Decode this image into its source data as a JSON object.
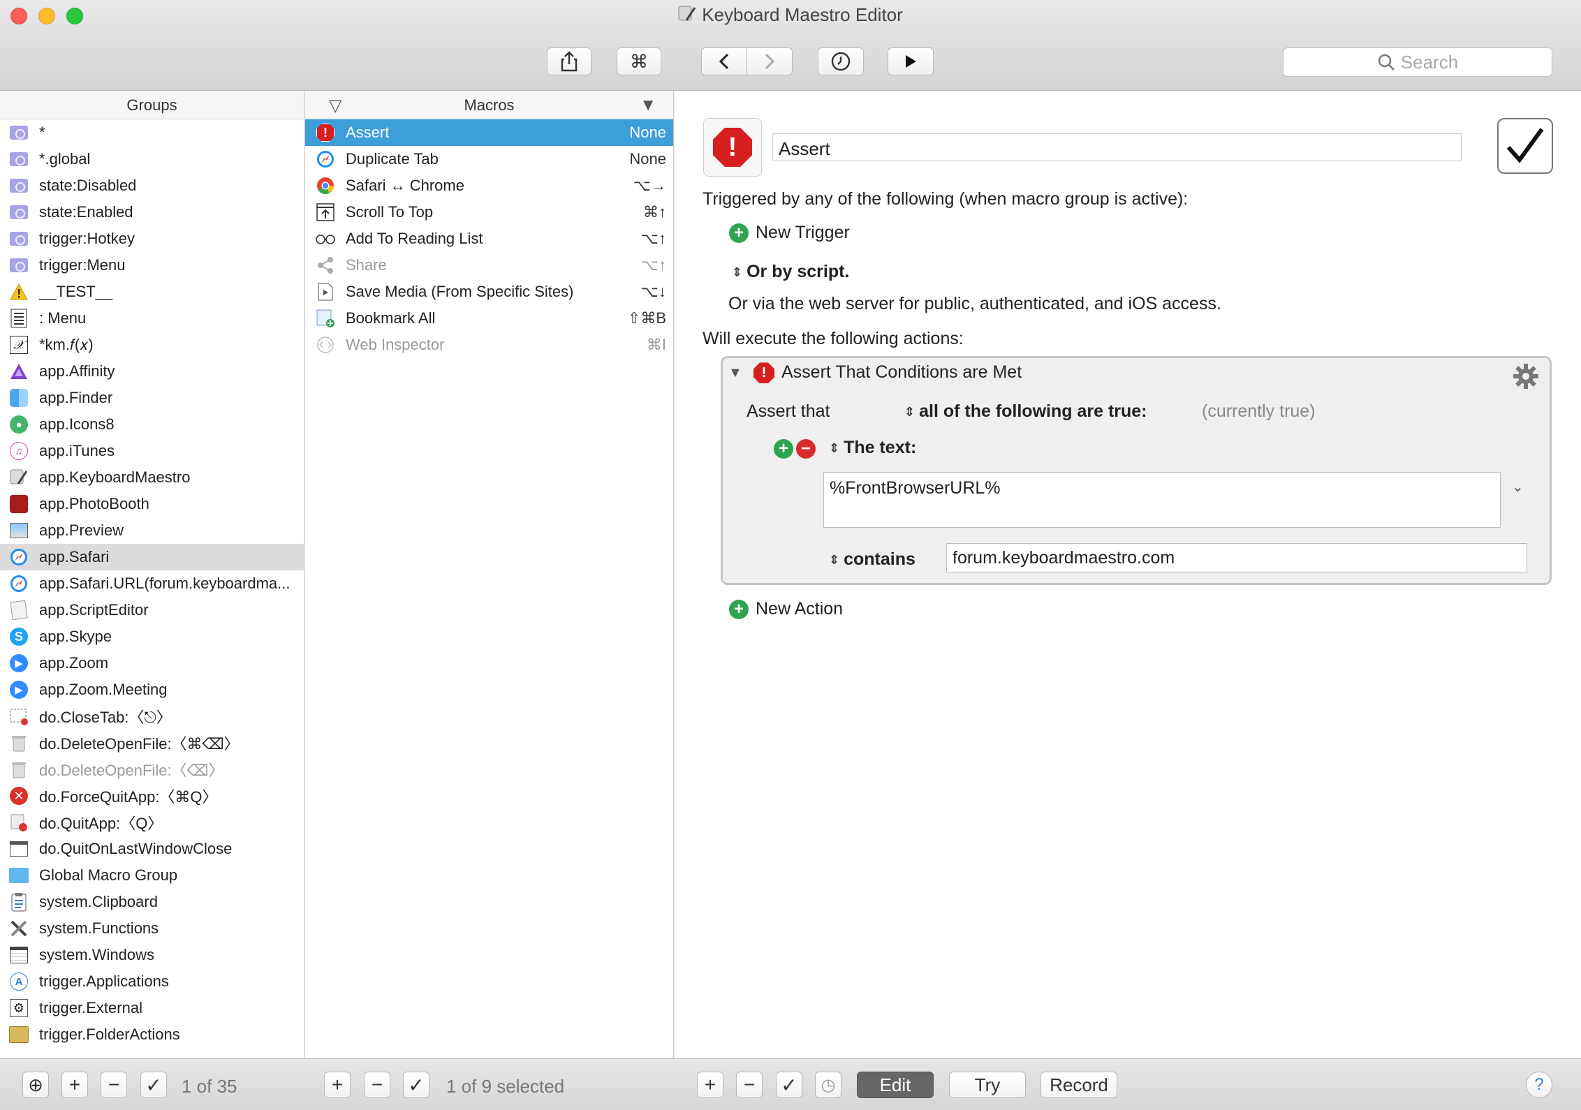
{
  "window": {
    "title": "Keyboard Maestro Editor"
  },
  "toolbar": {
    "search_placeholder": "Search"
  },
  "groups": {
    "header": "Groups",
    "count": "1 of 35",
    "items": [
      {
        "label": "*",
        "icon": "smart-group-icon"
      },
      {
        "label": "*.global",
        "icon": "smart-group-icon"
      },
      {
        "label": "state:Disabled",
        "icon": "smart-group-icon"
      },
      {
        "label": "state:Enabled",
        "icon": "smart-group-icon"
      },
      {
        "label": "trigger:Hotkey",
        "icon": "smart-group-icon"
      },
      {
        "label": "trigger:Menu",
        "icon": "smart-group-icon"
      },
      {
        "label": "__TEST__",
        "icon": "warning-icon"
      },
      {
        "label": ": Menu",
        "icon": "list-icon"
      },
      {
        "label": "*km.𝑓(𝑥)",
        "icon": "function-icon"
      },
      {
        "label": "app.Affinity",
        "icon": "affinity-icon"
      },
      {
        "label": "app.Finder",
        "icon": "finder-icon"
      },
      {
        "label": "app.Icons8",
        "icon": "icons8-icon"
      },
      {
        "label": "app.iTunes",
        "icon": "itunes-icon"
      },
      {
        "label": "app.KeyboardMaestro",
        "icon": "keyboard-maestro-icon"
      },
      {
        "label": "app.PhotoBooth",
        "icon": "photobooth-icon"
      },
      {
        "label": "app.Preview",
        "icon": "preview-icon"
      },
      {
        "label": "app.Safari",
        "icon": "safari-icon"
      },
      {
        "label": "app.Safari.URL(forum.keyboardma...",
        "icon": "safari-icon"
      },
      {
        "label": "app.ScriptEditor",
        "icon": "script-editor-icon"
      },
      {
        "label": "app.Skype",
        "icon": "skype-icon"
      },
      {
        "label": "app.Zoom",
        "icon": "zoom-icon"
      },
      {
        "label": "app.Zoom.Meeting",
        "icon": "zoom-icon"
      },
      {
        "label": "do.CloseTab:〈⎋〉",
        "icon": "close-tab-icon"
      },
      {
        "label": "do.DeleteOpenFile:〈⌘⌫〉",
        "icon": "trash-icon"
      },
      {
        "label": "do.DeleteOpenFile:〈⌫〉",
        "icon": "trash-icon"
      },
      {
        "label": "do.ForceQuitApp:〈⌘Q〉",
        "icon": "force-quit-icon"
      },
      {
        "label": "do.QuitApp:〈Q〉",
        "icon": "quit-app-icon"
      },
      {
        "label": "do.QuitOnLastWindowClose",
        "icon": "window-icon"
      },
      {
        "label": "Global Macro Group",
        "icon": "folder-icon"
      },
      {
        "label": "system.Clipboard",
        "icon": "clipboard-icon"
      },
      {
        "label": "system.Functions",
        "icon": "tools-icon"
      },
      {
        "label": "system.Windows",
        "icon": "windows-icon"
      },
      {
        "label": "trigger.Applications",
        "icon": "app-store-icon"
      },
      {
        "label": "trigger.External",
        "icon": "gear-icon"
      },
      {
        "label": "trigger.FolderActions",
        "icon": "folder-actions-icon"
      }
    ]
  },
  "macros": {
    "header": "Macros",
    "count": "1 of 9 selected",
    "items": [
      {
        "label": "Assert",
        "shortcut": "None",
        "icon": "stop-icon"
      },
      {
        "label": "Duplicate Tab",
        "shortcut": "None",
        "icon": "safari-icon"
      },
      {
        "label": "Safari ↔ Chrome",
        "shortcut": "⌥→",
        "icon": "chrome-icon"
      },
      {
        "label": "Scroll To Top",
        "shortcut": "⌘↑",
        "icon": "scroll-top-icon"
      },
      {
        "label": "Add To Reading List",
        "shortcut": "⌥↑",
        "icon": "glasses-icon"
      },
      {
        "label": "Share",
        "shortcut": "⌥↑",
        "icon": "share-icon"
      },
      {
        "label": "Save Media (From Specific Sites)",
        "shortcut": "⌥↓",
        "icon": "media-icon"
      },
      {
        "label": "Bookmark All",
        "shortcut": "⇧⌘B",
        "icon": "bookmark-icon"
      },
      {
        "label": "Web Inspector",
        "shortcut": "⌘I",
        "icon": "web-inspector-icon"
      }
    ]
  },
  "editor": {
    "macro_name": "Assert",
    "triggered_by": "Triggered by any of the following (when macro group is active):",
    "new_trigger": "New Trigger",
    "or_by_script": "Or by script.",
    "web_server": "Or via the web server for public, authenticated, and iOS access.",
    "will_execute": "Will execute the following actions:",
    "action": {
      "title": "Assert That Conditions are Met",
      "assert_that": "Assert that",
      "condition_mode": "all of the following are true:",
      "status": "(currently true)",
      "text_label": "The text:",
      "text_value": "%FrontBrowserURL%",
      "operator": "contains",
      "operand": "forum.keyboardmaestro.com"
    },
    "new_action": "New Action"
  },
  "bottombar": {
    "edit": "Edit",
    "try": "Try",
    "record": "Record",
    "help": "?"
  },
  "colors": {
    "selection": "#3d9ed9",
    "stop_red": "#d62020",
    "add_green": "#2ea44f"
  }
}
